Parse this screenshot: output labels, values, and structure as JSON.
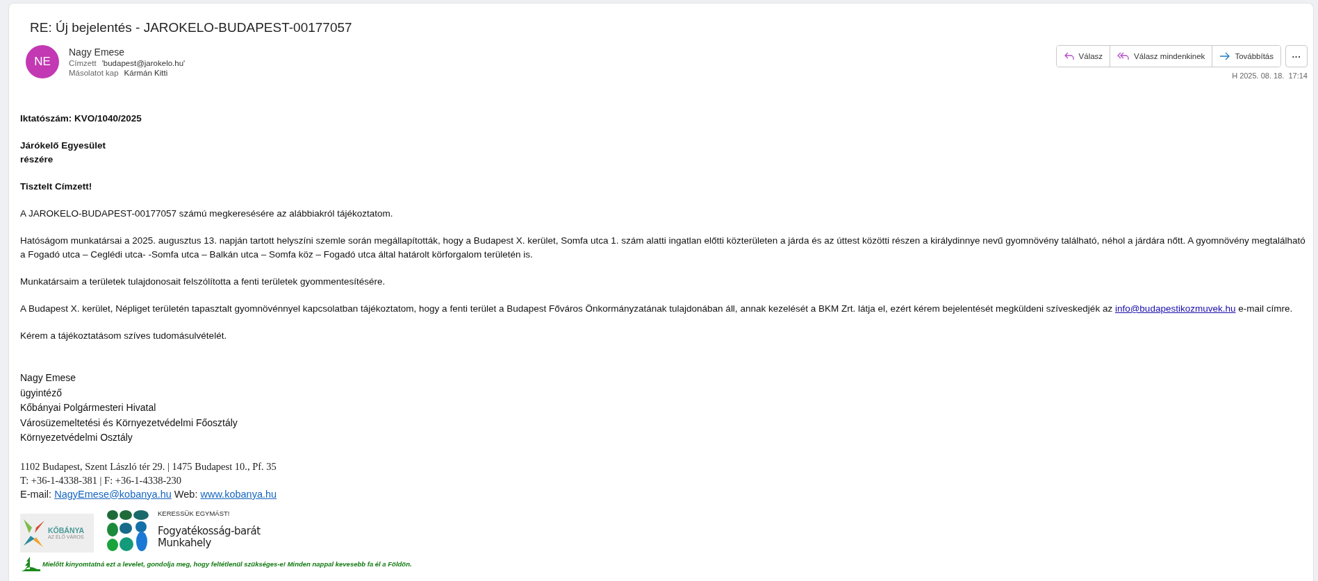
{
  "message": {
    "subject": "RE: Új bejelentés - JAROKELO-BUDAPEST-00177057",
    "sender": {
      "initials": "NE",
      "name": "Nagy Emese",
      "color": "#c239b3"
    },
    "recipients": [
      {
        "label": "Címzett",
        "value": "'budapest@jarokelo.hu'"
      },
      {
        "label": "Másolatot kap",
        "value": "Kármán Kitti"
      }
    ],
    "actions": [
      {
        "label": "Válasz",
        "kind": "reply"
      },
      {
        "label": "Válasz mindenkinek",
        "kind": "reply-all"
      },
      {
        "label": "Továbbítás",
        "kind": "forward"
      }
    ],
    "more": "···",
    "date": "H 2025. 08. 18.  17:14"
  },
  "body": [
    {
      "kind": "bold",
      "lines": [
        "Iktatószám: KVO/1040/2025"
      ]
    },
    {
      "kind": "bold",
      "lines": [
        "Járókelő Egyesület",
        "részére"
      ]
    },
    {
      "kind": "bold",
      "lines": [
        "Tisztelt Címzett!"
      ]
    },
    {
      "kind": "plain",
      "segments": [
        {
          "text": "A JAROKELO-BUDAPEST-00177057 számú megkeresésére az alábbiakról tájékoztatom."
        }
      ]
    },
    {
      "kind": "plain",
      "segments": [
        {
          "text": "Hatóságom munkatársai a 2025. augusztus 13. napján tartott helyszíni szemle során megállapították, hogy a Budapest X. kerület, Somfa utca 1. szám alatti ingatlan előtti közterületen a járda és az úttest közötti részen a királydinnye nevű gyomnövény található, néhol a járdára nőtt. A gyomnövény megtalálható a Fogadó utca – Ceglédi utca- -Somfa utca – Balkán utca – Somfa köz – Fogadó utca által határolt körforgalom területén is."
        }
      ]
    },
    {
      "kind": "plain",
      "segments": [
        {
          "text": "Munkatársaim a területek tulajdonosait felszólította a fenti területek gyommentesítésére."
        }
      ]
    },
    {
      "kind": "plain",
      "segments": [
        {
          "text": "A Budapest X. kerület, Népliget területén tapasztalt gyomnövénnyel kapcsolatban tájékoztatom, hogy a fenti terület a Budapest Főváros Önkormányzatának tulajdonában áll, annak kezelését a BKM Zrt. látja el, ezért kérem bejelentését megküldeni szíveskedjék az "
        },
        {
          "link": "info@budapestikozmuvek.hu"
        },
        {
          "text": " e-mail címre."
        }
      ]
    },
    {
      "kind": "plain",
      "segments": [
        {
          "text": "Kérem a tájékoztatásom szíves tudomásulvételét."
        }
      ]
    }
  ],
  "signature": {
    "lines": [
      "Nagy Emese",
      "ügyintéző",
      "Kőbányai Polgármesteri Hivatal",
      "Városüzemeltetési és Környezetvédelmi Főosztály",
      "Környezetvédelmi Osztály"
    ],
    "contact": [
      [
        {
          "text": "1102 Budapest, Szent László tér 29.  |  1475 Budapest 10., Pf. 35"
        }
      ],
      [
        {
          "text": "T: +36-1-4338-381 | F: +36-1-4338-230"
        }
      ],
      [
        {
          "label": "E-mail: "
        },
        {
          "link": "NagyEmese@kobanya.hu"
        },
        {
          "label": " Web: "
        },
        {
          "link": "www.kobanya.hu"
        }
      ]
    ],
    "logos": {
      "city": {
        "name": "KŐBÁNYA",
        "tagline": "AZ ÉLŐ VÁROS"
      },
      "workplace": {
        "slogan": "KERESSÜK EGYMÁST!",
        "title": "Fogyatékosság-barát",
        "subtitle": "Munkahely"
      }
    },
    "footer": "Mielőtt kinyomtatná ezt a levelet, gondolja meg, hogy feltétlenül szükséges-e! Minden nappal kevesebb fa él a Földön."
  }
}
